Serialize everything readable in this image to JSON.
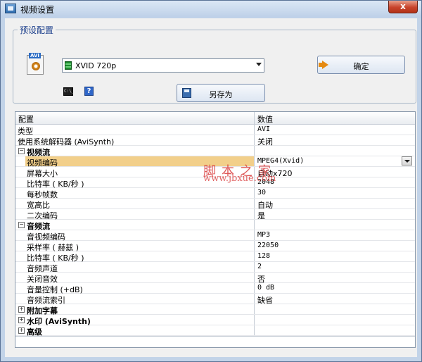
{
  "window": {
    "title": "视频设置",
    "close_label": "x"
  },
  "preset": {
    "group_label": "预设配置",
    "avi_tag": "AVI",
    "combo_value": "XVID 720p",
    "ok_label": "确定",
    "save_as_label": "另存为",
    "cmd_label": "C:\\_",
    "help_label": "?"
  },
  "grid": {
    "header": {
      "col1": "配置",
      "col2": "数值"
    },
    "rows": [
      {
        "key": "类型",
        "value": "AVI"
      },
      {
        "key": "使用系统解码器 (AviSynth)",
        "value": "关闭"
      },
      {
        "key": "视频流",
        "expander": "−"
      },
      {
        "key": "视频编码",
        "value": "MPEG4(Xvid)"
      },
      {
        "key": "屏幕大小",
        "value": "自动x720"
      },
      {
        "key": "比特率 ( KB/秒 )",
        "value": "2048"
      },
      {
        "key": "每秒帧数",
        "value": "30"
      },
      {
        "key": "宽高比",
        "value": "自动"
      },
      {
        "key": "二次编码",
        "value": "是"
      },
      {
        "key": "音频流",
        "expander": "−"
      },
      {
        "key": "音视频编码",
        "value": "MP3"
      },
      {
        "key": "采样率 ( 赫兹 )",
        "value": "22050"
      },
      {
        "key": "比特率 ( KB/秒 )",
        "value": "128"
      },
      {
        "key": "音频声道",
        "value": "2"
      },
      {
        "key": "关闭音效",
        "value": "否"
      },
      {
        "key": "音量控制 (+dB)",
        "value": "0 dB"
      },
      {
        "key": "音频流索引",
        "value": "缺省"
      },
      {
        "key": "附加字幕",
        "expander": "+"
      },
      {
        "key": "水印 (AviSynth)",
        "expander": "+"
      },
      {
        "key": "高级",
        "expander": "+"
      }
    ]
  },
  "watermark": {
    "line1": "脚本之家",
    "line2": "www.jbxue.com"
  },
  "colors": {
    "selection": "#f2cf8a",
    "group_label": "#1c3f8c",
    "watermark": "#d93b3b"
  }
}
